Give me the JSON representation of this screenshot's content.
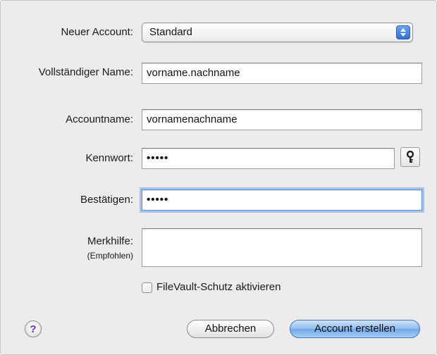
{
  "form": {
    "account_type_label": "Neuer Account:",
    "account_type_value": "Standard",
    "fullname_label": "Vollständiger Name:",
    "fullname_value": "vorname.nachname",
    "accountname_label": "Accountname:",
    "accountname_value": "vornamenachname",
    "password_label": "Kennwort:",
    "password_value": "•••••",
    "confirm_label": "Bestätigen:",
    "confirm_value": "•••••",
    "hint_label": "Merkhilfe:",
    "hint_sublabel": "(Empfohlen)",
    "hint_value": "",
    "filevault_label": "FileVault-Schutz aktivieren",
    "filevault_checked": false
  },
  "buttons": {
    "help_label": "?",
    "cancel_label": "Abbrechen",
    "create_label": "Account erstellen"
  },
  "icons": {
    "password_assistant": "key-icon",
    "select_arrows": "updown-arrows-icon"
  },
  "colors": {
    "focus_ring": "#6ea0e6",
    "primary_button": "#8ebcef",
    "help_mark": "#6a2bd1"
  }
}
